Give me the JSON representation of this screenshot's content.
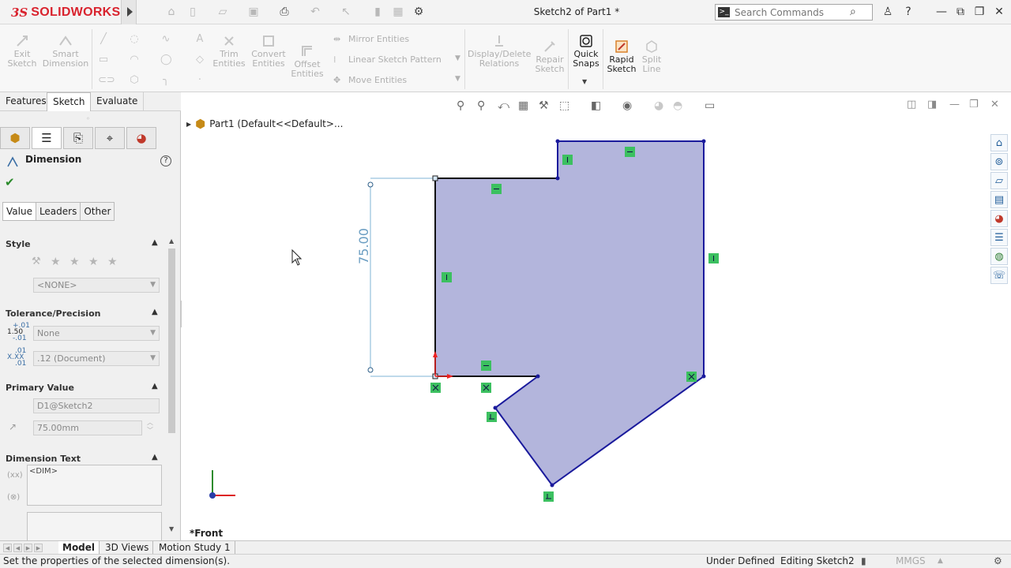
{
  "app": {
    "logo_ds": "3S",
    "logo_word": "SOLIDWORKS",
    "document_title": "Sketch2 of Part1 *",
    "search_placeholder": "Search Commands"
  },
  "command_manager": {
    "exit_sketch": [
      "Exit",
      "Sketch"
    ],
    "smart_dimension": [
      "Smart",
      "Dimension"
    ],
    "trim_entities": [
      "Trim",
      "Entities"
    ],
    "convert_entities": [
      "Convert",
      "Entities"
    ],
    "offset_entities": [
      "Offset",
      "Entities"
    ],
    "mirror_entities": "Mirror Entities",
    "linear_sketch_pattern": "Linear Sketch Pattern",
    "move_entities": "Move Entities",
    "display_delete_relations": [
      "Display/Delete",
      "Relations"
    ],
    "repair_sketch": [
      "Repair",
      "Sketch"
    ],
    "quick_snaps": [
      "Quick",
      "Snaps"
    ],
    "rapid_sketch": [
      "Rapid",
      "Sketch"
    ],
    "split_line": [
      "Split",
      "Line"
    ]
  },
  "manager_tabs": [
    "Features",
    "Sketch",
    "Evaluate"
  ],
  "active_manager_tab": "Sketch",
  "property_manager": {
    "title": "Dimension",
    "tabs": [
      "Value",
      "Leaders",
      "Other"
    ],
    "style": {
      "header": "Style",
      "style_value": "<NONE>"
    },
    "tolerance": {
      "header": "Tolerance/Precision",
      "tolerance_type": "None",
      "precision": ".12 (Document)",
      "tol_icon_text": [
        "+.01",
        "1.50",
        "-.01"
      ],
      "prec_icon_text": [
        ".01",
        "X.XX",
        ".01"
      ]
    },
    "primary_value": {
      "header": "Primary Value",
      "name": "D1@Sketch2",
      "value": "75.00mm"
    },
    "dimension_text": {
      "header": "Dimension Text",
      "text": "<DIM>"
    }
  },
  "feature_tree": {
    "node": "Part1  (Default<<Default>...",
    "view": "*Front"
  },
  "sketch": {
    "dimension_value": "75.00"
  },
  "bottom_tabs": [
    "Model",
    "3D Views",
    "Motion Study 1"
  ],
  "status_bar": {
    "message": "Set the properties of the selected dimension(s).",
    "sketch_status": "Under Defined",
    "editing": "Editing Sketch2",
    "units": "MMGS"
  }
}
